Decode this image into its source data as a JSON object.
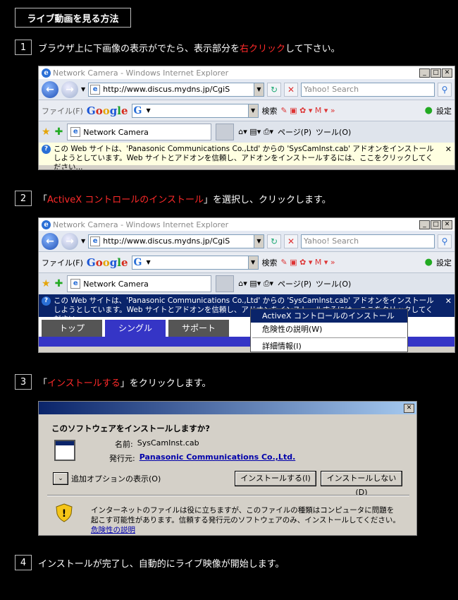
{
  "page_title": "ライブ動画を見る方法",
  "steps": [
    {
      "number": "1",
      "pre": "ブラウザ上に下画像の表示がでたら、表示部分を",
      "highlight": "右クリック",
      "post": "して下さい。"
    },
    {
      "number": "2",
      "pre": "「",
      "highlight": "ActiveX コントロールのインストール",
      "post": "」を選択し、クリックします。"
    },
    {
      "number": "3",
      "pre": "「",
      "highlight": "インストールする",
      "post": "」をクリックします。"
    },
    {
      "number": "4",
      "pre": "インストールが完了し、自動的にライブ映像が開始します。",
      "highlight": "",
      "post": ""
    }
  ],
  "browser": {
    "window_title": "Network Camera - Windows Internet Explorer",
    "address": "http://www.discus.mydns.jp/CgiS",
    "search_placeholder": "Yahoo! Search",
    "file_menu": "ファイル(F)",
    "google_logo": "Google",
    "search_button": "検索",
    "settings": "設定",
    "tab_label": "Network Camera",
    "page_menu": "ページ(P)",
    "tools_menu": "ツール(O)",
    "infobar_text": "この Web サイトは、'Panasonic Communications Co.,Ltd' からの 'SysCamInst.cab' アドオンをインストールしようとしています。Web サイトとアドオンを信頼し、アドオンをインストールするには、ここをクリックしてください..."
  },
  "context_menu": {
    "install": "ActiveX コントロールのインストール(C)...",
    "risk": "危険性の説明(W)",
    "info": "詳細情報(I)"
  },
  "site_tabs": [
    "トップ",
    "シングル",
    "サポート"
  ],
  "dialog": {
    "question": "このソフトウェアをインストールしますか?",
    "name_label": "名前:",
    "name_value": "SysCamInst.cab",
    "publisher_label": "発行元:",
    "publisher_value": "Panasonic Communications Co.,Ltd.",
    "more_options": "追加オプションの表示(O)",
    "install_button": "インストールする(I)",
    "dont_install_button": "インストールしない(D)",
    "warning_text": "インターネットのファイルは役に立ちますが、このファイルの種類はコンピュータに問題を起こす可能性があります。信頼する発行元のソフトウェアのみ、インストールしてください。",
    "risk_link": "危険性の説明"
  }
}
